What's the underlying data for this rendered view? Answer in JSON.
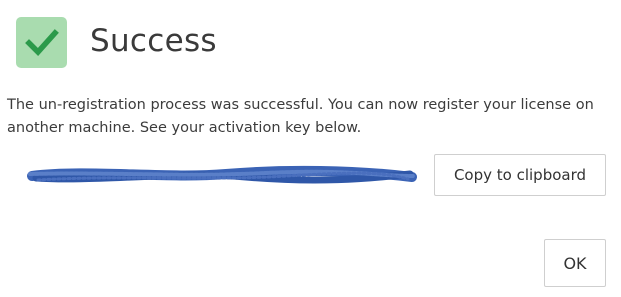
{
  "dialog": {
    "title": "Success",
    "status_icon": "checkmark-icon",
    "message": "The un-registration process was successful. You can now register your license on another machine. See your activation key below.",
    "activation_key": {
      "redacted": true,
      "scribble_color": "#3b63b5"
    },
    "copy_button_label": "Copy to clipboard",
    "ok_button_label": "OK"
  },
  "colors": {
    "check_tile": "#a9dcaf",
    "check_mark": "#2b9a4a",
    "text": "#333333",
    "button_border": "#cfcfcf"
  }
}
